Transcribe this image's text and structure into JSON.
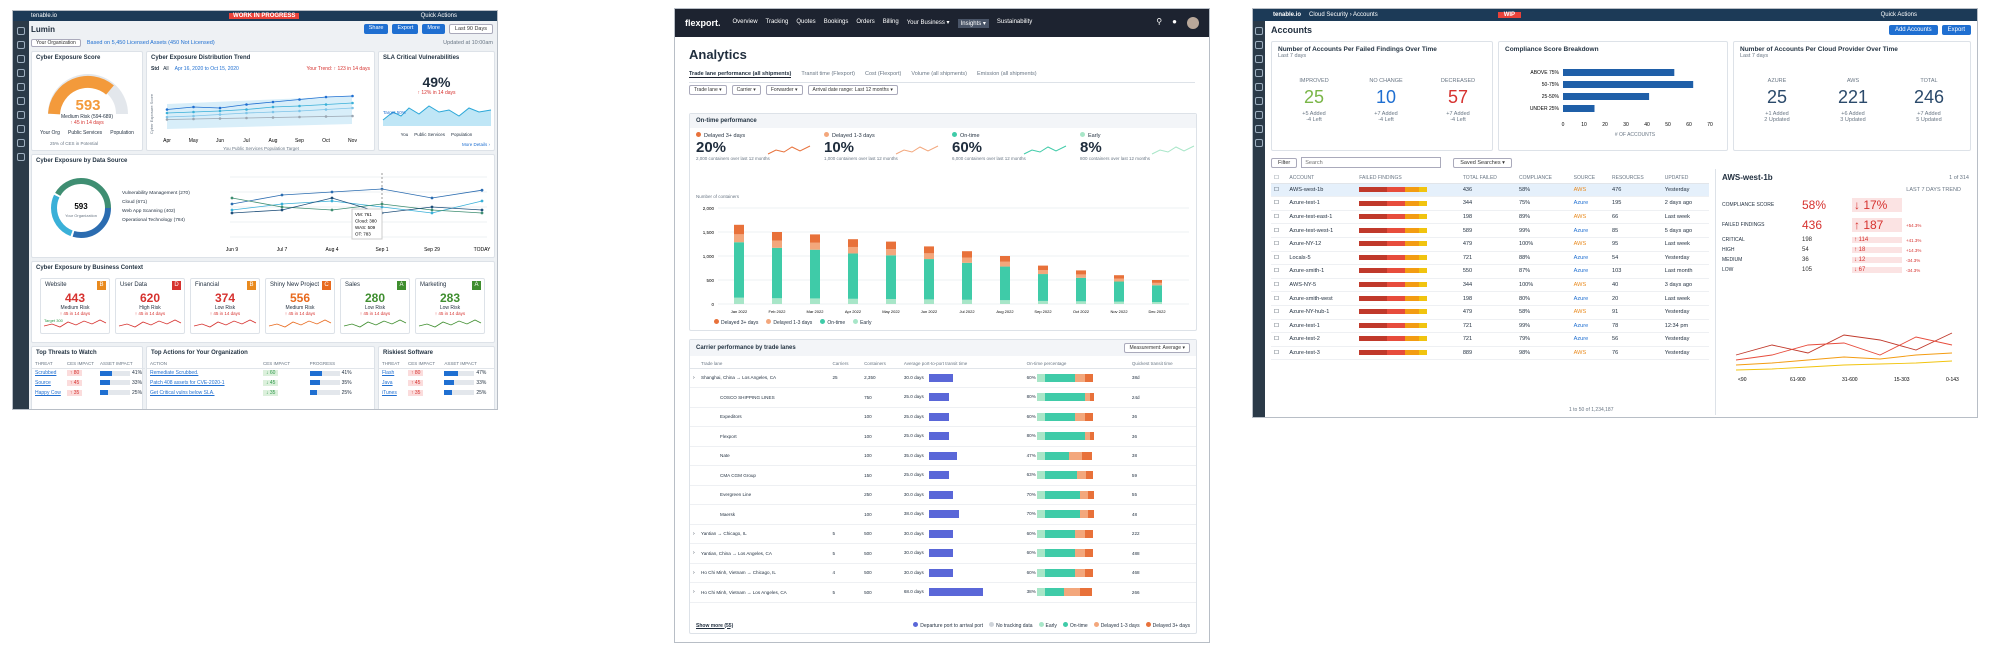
{
  "lumin": {
    "brand": "tenable.io",
    "wip": "WORK IN PROGRESS",
    "quick_actions": "Quick Actions",
    "app_title": "Lumin",
    "share": "Share",
    "export": "Export",
    "more": "More",
    "range": "Last 90 Days",
    "org": "Your Organization",
    "assets_note": "Based on 5,450 Licensed Assets (450 Not Licensed)",
    "updated": "Updated at 10:00am",
    "ces_title": "Cyber Exposure Score",
    "ces_value": "593",
    "ces_risk": "Medium Risk (594-689)",
    "ces_change": "↑ 45 in 14 days",
    "gauge_labels": [
      "Your Org",
      "Public Services",
      "Population"
    ],
    "gauge_vals": [
      "1000",
      "0"
    ],
    "target": "Target",
    "ces_small": [
      "593",
      "550",
      "670"
    ],
    "ces_legend": "25% of CES in Potential",
    "trend_title": "Cyber Exposure Distribution Trend",
    "trend_range": "Apr 16, 2020 to Oct 15, 2020",
    "trend_note": "Your Trend: ↑ 123 in 14 days",
    "trend_tabs": [
      "Std",
      "All"
    ],
    "trend_months": [
      "Apr",
      "May",
      "Jun",
      "Jul",
      "Aug",
      "Sep",
      "Oct",
      "Nov"
    ],
    "trend_legend": [
      "You",
      "Public Services",
      "Population",
      "Target"
    ],
    "trend_ylabel": "Cyber Exposure Score",
    "sla_title": "SLA Critical Vulnerabilities",
    "sla_value": "49%",
    "sla_change": "↑ 12% in 14 days",
    "sla_target": "Target 50%",
    "sla_legend": [
      "You",
      "Public Services",
      "Population"
    ],
    "sla_more": "More Details ›",
    "src_title": "Cyber Exposure by Data Source",
    "src_score": "593",
    "src_sub": "Your Organization",
    "src_legend": [
      "Vulnerability Management (270)",
      "Cloud (671)",
      "Web App Scanning (402)",
      "Operational Technology (784)"
    ],
    "src_xlabels": [
      "Jun 9",
      "Jul 7",
      "Aug 4",
      "Sep 1",
      "Sep 29",
      "TODAY"
    ],
    "src_tooltip": [
      "VM: 761",
      "Cloud: 380",
      "WAS: 509",
      "OT: 783"
    ],
    "ctx_title": "Cyber Exposure by Business Context",
    "tiles": [
      {
        "name": "Website",
        "grade": "B",
        "value": "443",
        "risk": "Medium Risk",
        "change": "↑ 45 in 14 days",
        "target": "Target 300"
      },
      {
        "name": "User Data",
        "grade": "D",
        "value": "620",
        "risk": "High Risk",
        "change": "↑ 45 in 14 days"
      },
      {
        "name": "Financial",
        "grade": "B",
        "value": "374",
        "risk": "Low Risk",
        "change": "↑ 45 in 14 days"
      },
      {
        "name": "Shiny New Project",
        "grade": "C",
        "value": "556",
        "risk": "Medium Risk",
        "change": "↑ 45 in 14 days"
      },
      {
        "name": "Sales",
        "grade": "A",
        "value": "280",
        "risk": "Low Risk",
        "change": "↑ 45 in 14 days"
      },
      {
        "name": "Marketing",
        "grade": "A",
        "value": "283",
        "risk": "Low Risk",
        "change": "↑ 45 in 14 days"
      }
    ],
    "threats_title": "Top Threats to Watch",
    "threats_cols": [
      "THREAT",
      "CES IMPACT",
      "ASSET IMPACT"
    ],
    "threats": [
      [
        "Scrubbed",
        "↑ 80",
        "41%"
      ],
      [
        "Source",
        "↑ 45",
        "33%"
      ],
      [
        "Happy Cow",
        "↑ 35",
        "25%"
      ]
    ],
    "actions_title": "Top Actions for Your Organization",
    "actions_cols": [
      "ACTION",
      "CES IMPACT",
      "PROGRESS"
    ],
    "actions": [
      [
        "Remediate Scrubbed.",
        "↓ 60",
        "41%"
      ],
      [
        "Patch 408 assets for CVE-2020-1",
        "↓ 45",
        "35%"
      ],
      [
        "Get Critical vulns below SLA.",
        "↓ 35",
        "25%"
      ]
    ],
    "risky_title": "Riskiest Software",
    "risky_cols": [
      "THREAT",
      "CES IMPACT",
      "ASSET IMPACT"
    ],
    "risky": [
      [
        "Flash",
        "↑ 80",
        "47%"
      ],
      [
        "Java",
        "↑ 45",
        "33%"
      ],
      [
        "iTunes",
        "↑ 35",
        "25%"
      ]
    ]
  },
  "flexport": {
    "brand": "flexport.",
    "nav": [
      "Overview",
      "Tracking",
      "Quotes",
      "Bookings",
      "Orders",
      "Billing",
      "Your Business ▾",
      "Insights ▾",
      "Sustainability"
    ],
    "title": "Analytics",
    "tabs": [
      "Trade lane performance (all shipments)",
      "Transit time (Flexport)",
      "Cost (Flexport)",
      "Volume (all shipments)",
      "Emission (all shipments)"
    ],
    "filters": [
      "Trade lane ▾",
      "Carrier ▾",
      "Forwarder ▾",
      "Arrival date range: Last 12 months ▾"
    ],
    "ontime_title": "On-time performance",
    "kpis": [
      {
        "label": "Delayed 3+ days",
        "value": "20%",
        "sub": "2,000 containers over last 12 months",
        "color": "#e8713a"
      },
      {
        "label": "Delayed 1-3 days",
        "value": "10%",
        "sub": "1,000 containers over last 12 months",
        "color": "#f3a77c"
      },
      {
        "label": "On-time",
        "value": "60%",
        "sub": "6,000 containers over last 12 months",
        "color": "#3fcba8"
      },
      {
        "label": "Early",
        "value": "8%",
        "sub": "800 containers over last 12 months",
        "color": "#a8e6c8"
      }
    ],
    "bars_ylabel": "Number of containers",
    "bars_y": [
      "2,000",
      "1,500",
      "1,000",
      "500",
      "0"
    ],
    "bars_x": [
      "Jan 2022",
      "Feb 2022",
      "Mar 2022",
      "Apr 2022",
      "May 2022",
      "Jun 2022",
      "Jul 2022",
      "Aug 2022",
      "Sep 2022",
      "Oct 2022",
      "Nov 2022",
      "Dec 2022"
    ],
    "bars_legend": [
      "Delayed 3+ days",
      "Delayed 1-3 days",
      "On-time",
      "Early"
    ],
    "carrier_title": "Carrier performance by trade lanes",
    "measurement": "Measurement: Average ▾",
    "carrier_cols": [
      "Trade lane",
      "Carriers",
      "Containers",
      "Average port-to-port transit time",
      "On-time percentage",
      "Quickest transit time"
    ],
    "carrier_rows": [
      [
        "Shanghai, China → Los Angeles, CA",
        "25",
        "2,350",
        "30.0 days",
        "60%",
        "38d"
      ],
      [
        "COSCO SHIPPING LINES",
        "",
        "750",
        "25.0 days",
        "80%",
        "24d"
      ],
      [
        "Expeditors",
        "",
        "100",
        "25.0 days",
        "60%",
        "36"
      ],
      [
        "Flexport",
        "",
        "100",
        "25.0 days",
        "80%",
        "36"
      ],
      [
        "Nate",
        "",
        "100",
        "35.0 days",
        "47%",
        "38"
      ],
      [
        "CMA CGM Group",
        "",
        "150",
        "25.0 days",
        "63%",
        "59"
      ],
      [
        "Evergreen Line",
        "",
        "250",
        "30.0 days",
        "70%",
        "55"
      ],
      [
        "Maersk",
        "",
        "100",
        "38.0 days",
        "70%",
        "48"
      ],
      [
        "Yantian → Chicago, IL",
        "5",
        "500",
        "30.0 days",
        "60%",
        "222"
      ],
      [
        "Yantian, China → Los Angeles, CA",
        "5",
        "500",
        "30.0 days",
        "60%",
        "488"
      ],
      [
        "Ho Chi Minh, Vietnam → Chicago, IL",
        "4",
        "500",
        "30.0 days",
        "60%",
        "468"
      ],
      [
        "Ho Chi Minh, Vietnam → Los Angeles, CA",
        "5",
        "500",
        "68.0 days",
        "38%",
        "266"
      ]
    ],
    "show_more": "Show more (55)",
    "carrier_legend": [
      "Departure port to arrival port",
      "No tracking data",
      "Early",
      "On-time",
      "Delayed 1-3 days",
      "Delayed 3+ days"
    ]
  },
  "cloud": {
    "brand": "tenable.io",
    "crumb": "Cloud Security › Accounts",
    "wip": "WIP",
    "quick_actions": "Quick Actions",
    "title": "Accounts",
    "add_accounts": "Add Accounts",
    "export": "Export",
    "failed_title": "Number of Accounts Per Failed Findings Over Time",
    "failed_sub": "Last 7 days",
    "failed": [
      {
        "label": "IMPROVED",
        "value": "25",
        "s1": "+5 Added",
        "s2": "-4 Left"
      },
      {
        "label": "NO CHANGE",
        "value": "10",
        "s1": "+7 Added",
        "s2": "-4 Left"
      },
      {
        "label": "DECREASED",
        "value": "57",
        "s1": "+7 Added",
        "s2": "-4 Left"
      }
    ],
    "comp_title": "Compliance Score Breakdown",
    "comp_cats": [
      "ABOVE 75%",
      "50-75%",
      "25-50%",
      "UNDER 25%"
    ],
    "comp_vals": [
      53,
      62,
      41,
      15
    ],
    "comp_ticks": [
      "0",
      "10",
      "20",
      "30",
      "40",
      "50",
      "60",
      "70"
    ],
    "comp_xlabel": "# OF ACCOUNTS",
    "prov_title": "Number of Accounts Per Cloud Provider Over Time",
    "prov_sub": "Last 7 days",
    "prov": [
      {
        "label": "AZURE",
        "value": "25",
        "s1": "+1 Added",
        "s2": "2 Updated"
      },
      {
        "label": "AWS",
        "value": "221",
        "s1": "+6 Added",
        "s2": "3 Updated"
      },
      {
        "label": "TOTAL",
        "value": "246",
        "s1": "+7 Added",
        "s2": "5 Updated"
      }
    ],
    "filter": "Filter",
    "search_placeholder": "Search",
    "saved": "Saved Searches ▾",
    "cols": [
      "ACCOUNT",
      "FAILED FINDINGS",
      "TOTAL FAILED",
      "COMPLIANCE",
      "SOURCE",
      "RESOURCES",
      "UPDATED"
    ],
    "rows": [
      [
        "AWS-west-1b",
        "436",
        "58%",
        "AWS",
        "476",
        "Yesterday"
      ],
      [
        "Azure-test-1",
        "344",
        "75%",
        "Azure",
        "195",
        "2 days ago"
      ],
      [
        "Azure-test-east-1",
        "198",
        "89%",
        "AWS",
        "66",
        "Last week"
      ],
      [
        "Azure-test-west-1",
        "589",
        "99%",
        "Azure",
        "85",
        "5 days ago"
      ],
      [
        "Azure-NY-12",
        "479",
        "100%",
        "AWS",
        "95",
        "Last week"
      ],
      [
        "Locals-5",
        "721",
        "88%",
        "Azure",
        "54",
        "Yesterday"
      ],
      [
        "Azure-smith-1",
        "550",
        "87%",
        "Azure",
        "103",
        "Last month"
      ],
      [
        "AWS-NY-5",
        "344",
        "100%",
        "AWS",
        "40",
        "3 days ago"
      ],
      [
        "Azure-smith-west",
        "198",
        "80%",
        "Azure",
        "20",
        "Last week"
      ],
      [
        "Azure-NY-hub-1",
        "479",
        "58%",
        "AWS",
        "91",
        "Yesterday"
      ],
      [
        "Azure-test-1",
        "721",
        "99%",
        "Azure",
        "78",
        "12:34 pm"
      ],
      [
        "Azure-test-2",
        "721",
        "79%",
        "Azure",
        "56",
        "Yesterday"
      ],
      [
        "Azure-test-3",
        "889",
        "98%",
        "AWS",
        "76",
        "Yesterday"
      ]
    ],
    "pager": "1 to 50 of 1,234,187",
    "detail_title": "AWS-west-1b",
    "detail_page": "1 of 314",
    "trend_label": "LAST 7 DAYS TREND",
    "detail_rows": [
      {
        "label": "COMPLIANCE SCORE",
        "value": "58%",
        "trend": "↓ 17%",
        "big": true
      },
      {
        "label": "FAILED FINDINGS",
        "value": "436",
        "trend": "↑ 187",
        "pct": "+54.3%",
        "big": true
      },
      {
        "label": "CRITICAL",
        "value": "198",
        "trend": "↑ 114",
        "pct": "+41.3%"
      },
      {
        "label": "HIGH",
        "value": "54",
        "trend": "↑ 18",
        "pct": "+14.3%"
      },
      {
        "label": "MEDIUM",
        "value": "36",
        "trend": "↓ 12",
        "pct": "-34.3%"
      },
      {
        "label": "LOW",
        "value": "105",
        "trend": "↓ 67",
        "pct": "-34.3%"
      }
    ],
    "detail_x": [
      "<90",
      "61-900",
      "31-600",
      "15-303",
      "0-143"
    ]
  }
}
